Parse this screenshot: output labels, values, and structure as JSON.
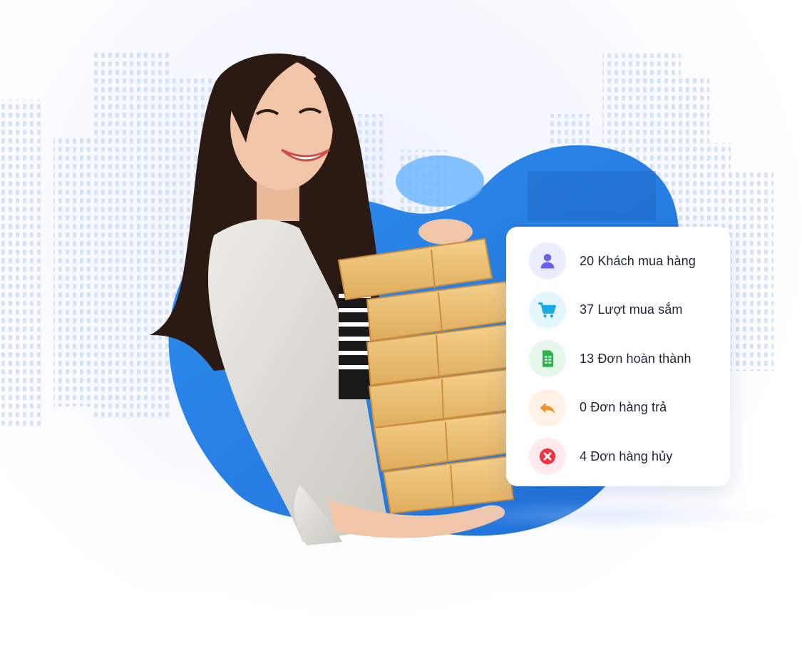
{
  "stats": {
    "items": [
      {
        "label": "20 Khách mua hàng",
        "icon": "user-icon",
        "bg": "#ececff",
        "fg": "#6c63e8"
      },
      {
        "label": "37 Lượt mua sắm",
        "icon": "cart-icon",
        "bg": "#e4f6fd",
        "fg": "#19a9e6"
      },
      {
        "label": "13 Đơn hoàn thành",
        "icon": "document-icon",
        "bg": "#e4f7ea",
        "fg": "#2cb34f"
      },
      {
        "label": "0 Đơn hàng trả",
        "icon": "return-arrow-icon",
        "bg": "#fff1e5",
        "fg": "#f2902b"
      },
      {
        "label": "4 Đơn hàng hủy",
        "icon": "cancel-icon",
        "bg": "#ffe9ec",
        "fg": "#ef3342"
      }
    ]
  }
}
